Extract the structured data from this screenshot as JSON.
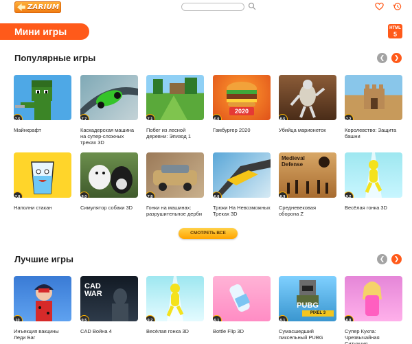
{
  "header": {
    "logo_text": "ZARIUM",
    "search_placeholder": ""
  },
  "banner": {
    "title": "Мини игры"
  },
  "html5_badge": {
    "top": "HTML",
    "num": "5"
  },
  "popular": {
    "title": "Популярные игры",
    "games": [
      {
        "name": "Майнкрафт",
        "rating": "7.5"
      },
      {
        "name": "Каскадерская машина на супер-сложных треках 3D",
        "rating": "7.7"
      },
      {
        "name": "Побег из лесной деревни: Эпизод 1",
        "rating": "7.1"
      },
      {
        "name": "Гамбургер 2020",
        "rating": "6.0"
      },
      {
        "name": "Убийца марионеток",
        "rating": "8.5"
      },
      {
        "name": "Королевство: Защита башни",
        "rating": "7.2"
      },
      {
        "name": "Наполни стакан",
        "rating": "7.8"
      },
      {
        "name": "Симулятор собаки 3D",
        "rating": "8.0"
      },
      {
        "name": "Гонки на машинах: разрушительное дерби",
        "rating": "7.8"
      },
      {
        "name": "Трюки На Невозможных Треках 3D",
        "rating": "6.8"
      },
      {
        "name": "Средневековая оборона Z",
        "rating": "8.9"
      },
      {
        "name": "Весёлая гонка 3D",
        "rating": "9.2"
      }
    ],
    "more_label": "СМОТРЕТЬ ВСЕ"
  },
  "best": {
    "title": "Лучшие игры",
    "games": [
      {
        "name": "Инъекция вакцины Леди Баг",
        "rating": "10"
      },
      {
        "name": "CAD Война 4",
        "rating": "9.5"
      },
      {
        "name": "Весёлая гонка 3D",
        "rating": "9.2"
      },
      {
        "name": "Bottle Flip 3D",
        "rating": "9.1"
      },
      {
        "name": "Сумасшедший пиксельный PUBG",
        "rating": "9.1"
      },
      {
        "name": "Супер Кукла: Чрезвычайная Ситуация",
        "rating": "8.8"
      }
    ]
  },
  "thumb_texts": {
    "burger": "2020",
    "medieval": "Medieval Defense",
    "cod": "CAD WAR",
    "pubg": "PUBG",
    "pubg_sub": "PIXEL 3"
  },
  "colors": {
    "accent": "#ff5a1a",
    "button": "#ffb400"
  }
}
